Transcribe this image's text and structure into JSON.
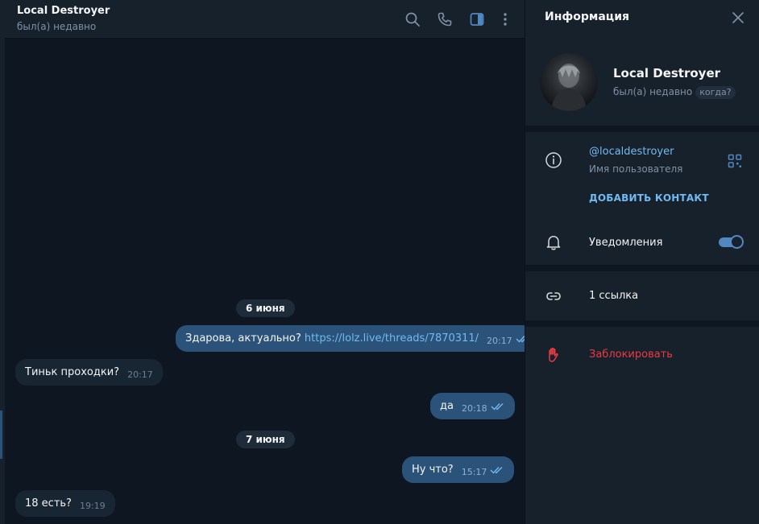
{
  "chat": {
    "title": "Local Destroyer",
    "status": "был(а) недавно",
    "dates": [
      "6 июня",
      "7 июня"
    ],
    "messages": [
      {
        "dir": "out",
        "text": "Здарова, актуально? ",
        "link": "https://lolz.live/threads/7870311/",
        "time": "20:17"
      },
      {
        "dir": "in",
        "text": "Тиньк проходки?",
        "time": "20:17"
      },
      {
        "dir": "out",
        "text": "да",
        "time": "20:18"
      },
      {
        "dir": "out",
        "text": "Ну что?",
        "time": "15:17"
      },
      {
        "dir": "in",
        "text": "18 есть?",
        "time": "19:19"
      }
    ]
  },
  "header_icons": [
    "search-icon",
    "phone-icon",
    "sidebar-toggle-icon",
    "more-vertical-icon"
  ],
  "info": {
    "title": "Информация",
    "name": "Local Destroyer",
    "status": "был(а) недавно",
    "when_badge": "когда?",
    "username": "@localdestroyer",
    "username_label": "Имя пользователя",
    "add_contact": "ДОБАВИТЬ КОНТАКТ",
    "notifications": "Уведомления",
    "notifications_on": true,
    "links": "1 ссылка",
    "block": "Заблокировать"
  },
  "colors": {
    "background": "#0e1621",
    "panel": "#17212b",
    "outgoing": "#2b5278",
    "incoming": "#182533",
    "accent": "#71baf2",
    "danger": "#ec3942"
  }
}
